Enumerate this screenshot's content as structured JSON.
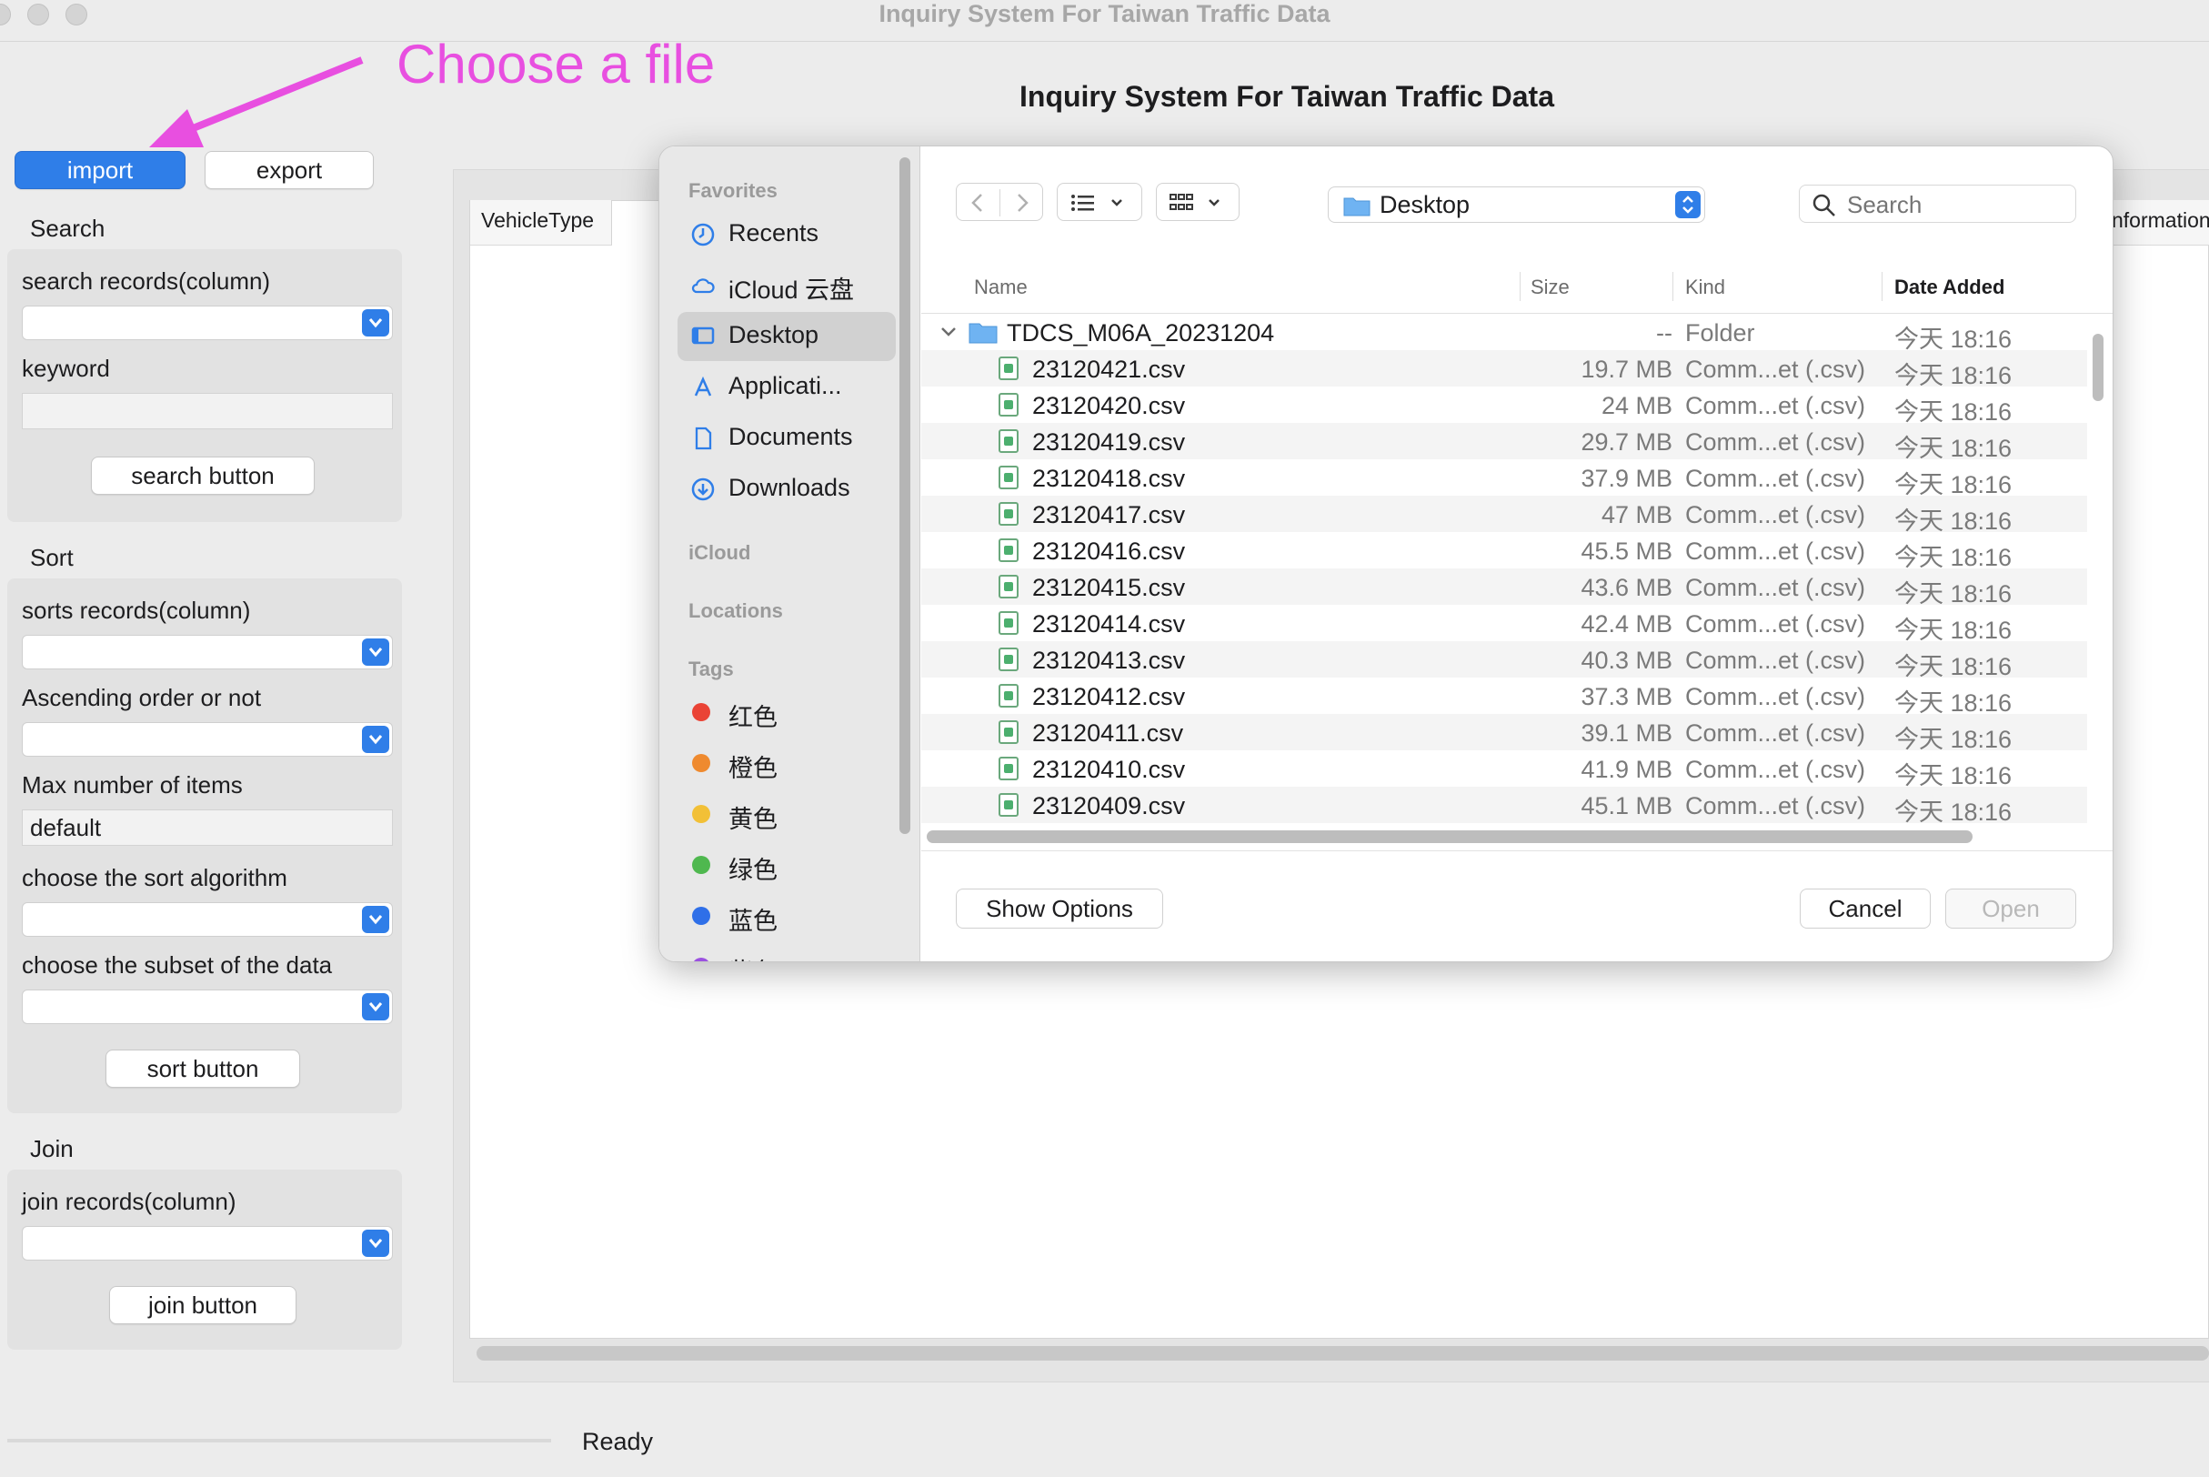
{
  "window": {
    "title": "Inquiry System For Taiwan Traffic Data"
  },
  "annotation": {
    "text": "Choose a file",
    "color": "#e84fe0"
  },
  "header": {
    "title": "Inquiry System For Taiwan Traffic Data"
  },
  "toolbar": {
    "import_label": "import",
    "export_label": "export"
  },
  "search": {
    "section_label": "Search",
    "column_label": "search records(column)",
    "column_value": "",
    "keyword_label": "keyword",
    "keyword_value": "",
    "button_label": "search button"
  },
  "sort": {
    "section_label": "Sort",
    "column_label": "sorts records(column)",
    "order_label": "Ascending order or not",
    "max_label": "Max number of items",
    "max_value": "default",
    "algorithm_label": "choose the sort algorithm",
    "subset_label": "choose the subset of the data",
    "button_label": "sort button"
  },
  "join": {
    "section_label": "Join",
    "column_label": "join records(column)",
    "button_label": "join button"
  },
  "table": {
    "columns": [
      "VehicleType",
      "nformation"
    ]
  },
  "status": {
    "text": "Ready"
  },
  "dialog": {
    "sidebar": {
      "favorites_label": "Favorites",
      "favorites": [
        {
          "label": "Recents",
          "icon": "clock-icon"
        },
        {
          "label": "iCloud 云盘",
          "icon": "cloud-icon"
        },
        {
          "label": "Desktop",
          "icon": "desktop-icon",
          "selected": true
        },
        {
          "label": "Applicati...",
          "icon": "applications-icon"
        },
        {
          "label": "Documents",
          "icon": "document-icon"
        },
        {
          "label": "Downloads",
          "icon": "download-icon"
        }
      ],
      "icloud_label": "iCloud",
      "locations_label": "Locations",
      "tags_label": "Tags",
      "tags": [
        {
          "label": "红色",
          "color": "#ea4335"
        },
        {
          "label": "橙色",
          "color": "#ef8a2f"
        },
        {
          "label": "黄色",
          "color": "#f2c037"
        },
        {
          "label": "绿色",
          "color": "#4fb84f"
        },
        {
          "label": "蓝色",
          "color": "#2f6fe8"
        },
        {
          "label": "紫色",
          "color": "#9b51e0"
        }
      ]
    },
    "location": "Desktop",
    "search_placeholder": "Search",
    "columns": {
      "name": "Name",
      "size": "Size",
      "kind": "Kind",
      "date": "Date Added"
    },
    "folder": {
      "name": "TDCS_M06A_20231204",
      "size": "--",
      "kind": "Folder",
      "date": "今天 18:16"
    },
    "files": [
      {
        "name": "23120421.csv",
        "size": "19.7 MB",
        "kind": "Comm...et (.csv)",
        "date": "今天 18:16"
      },
      {
        "name": "23120420.csv",
        "size": "24 MB",
        "kind": "Comm...et (.csv)",
        "date": "今天 18:16"
      },
      {
        "name": "23120419.csv",
        "size": "29.7 MB",
        "kind": "Comm...et (.csv)",
        "date": "今天 18:16"
      },
      {
        "name": "23120418.csv",
        "size": "37.9 MB",
        "kind": "Comm...et (.csv)",
        "date": "今天 18:16"
      },
      {
        "name": "23120417.csv",
        "size": "47 MB",
        "kind": "Comm...et (.csv)",
        "date": "今天 18:16"
      },
      {
        "name": "23120416.csv",
        "size": "45.5 MB",
        "kind": "Comm...et (.csv)",
        "date": "今天 18:16"
      },
      {
        "name": "23120415.csv",
        "size": "43.6 MB",
        "kind": "Comm...et (.csv)",
        "date": "今天 18:16"
      },
      {
        "name": "23120414.csv",
        "size": "42.4 MB",
        "kind": "Comm...et (.csv)",
        "date": "今天 18:16"
      },
      {
        "name": "23120413.csv",
        "size": "40.3 MB",
        "kind": "Comm...et (.csv)",
        "date": "今天 18:16"
      },
      {
        "name": "23120412.csv",
        "size": "37.3 MB",
        "kind": "Comm...et (.csv)",
        "date": "今天 18:16"
      },
      {
        "name": "23120411.csv",
        "size": "39.1 MB",
        "kind": "Comm...et (.csv)",
        "date": "今天 18:16"
      },
      {
        "name": "23120410.csv",
        "size": "41.9 MB",
        "kind": "Comm...et (.csv)",
        "date": "今天 18:16"
      },
      {
        "name": "23120409.csv",
        "size": "45.1 MB",
        "kind": "Comm...et (.csv)",
        "date": "今天 18:16"
      }
    ],
    "show_options_label": "Show Options",
    "cancel_label": "Cancel",
    "open_label": "Open"
  }
}
